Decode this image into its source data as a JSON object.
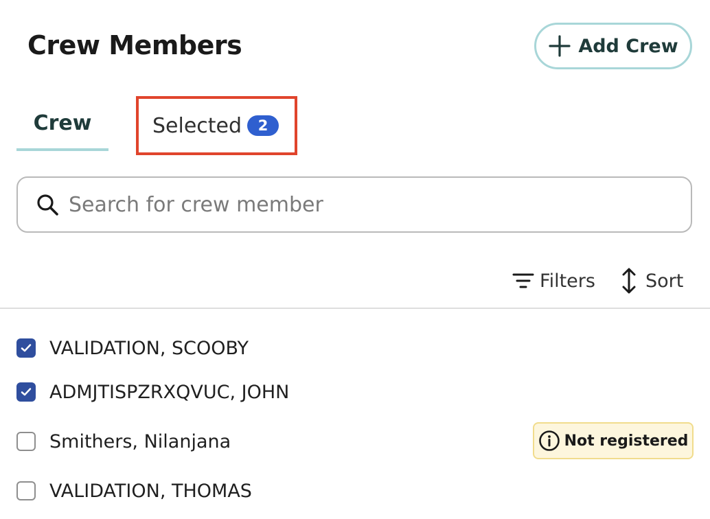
{
  "header": {
    "title": "Crew Members",
    "add_button_label": "Add Crew"
  },
  "tabs": [
    {
      "label": "Crew",
      "active": true
    },
    {
      "label": "Selected",
      "count": "2",
      "active": false
    }
  ],
  "search": {
    "placeholder": "Search for crew member",
    "value": ""
  },
  "toolbar": {
    "filters_label": "Filters",
    "sort_label": "Sort"
  },
  "crew_list": [
    {
      "name": "VALIDATION, SCOOBY",
      "checked": true
    },
    {
      "name": "ADMJTISPZRXQVUC, JOHN",
      "checked": true
    },
    {
      "name": "Smithers, Nilanjana",
      "checked": false,
      "badge": "Not registered"
    },
    {
      "name": "VALIDATION, THOMAS",
      "checked": false
    }
  ],
  "icons": {
    "add": "plus-icon",
    "search": "search-icon",
    "filters": "filter-icon",
    "sort": "sort-arrows-icon",
    "badge": "info-icon",
    "checkbox": "checkmark-icon"
  },
  "colors": {
    "accent": "#a8d6d8",
    "highlight_border": "#e0442c",
    "badge_blue": "#2f5fcf",
    "checkbox_checked": "#2f4e9e",
    "warning_bg": "#fdf6dd"
  }
}
